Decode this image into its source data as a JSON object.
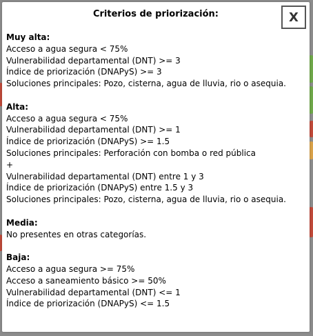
{
  "modal": {
    "title": "Criterios de priorización:",
    "close_label": "X"
  },
  "sections": {
    "muy_alta": {
      "title": "Muy alta:",
      "lines": [
        "Acceso a agua segura < 75%",
        "Vulnerabilidad departamental (DNT) >= 3",
        "Índice de priorización (DNAPyS) >= 3",
        "Soluciones principales: Pozo, cisterna, agua de lluvia, rio o asequia."
      ]
    },
    "alta": {
      "title": "Alta:",
      "lines": [
        "Acceso a agua segura < 75%",
        "Vulnerabilidad departamental (DNT) >= 1",
        "Índice de priorización (DNAPyS) >= 1.5",
        "Soluciones principales: Perforación con bomba o red pública",
        "+",
        "Vulnerabilidad departamental (DNT) entre 1 y 3",
        "Índice de priorización (DNAPyS) entre 1.5 y 3",
        "Soluciones principales: Pozo, cisterna, agua de lluvia, rio o asequia."
      ]
    },
    "media": {
      "title": "Media:",
      "lines": [
        "No presentes en otras categorías."
      ]
    },
    "baja": {
      "title": "Baja:",
      "lines": [
        "Acceso a agua segura >= 75%",
        "Acceso a saneamiento básico >= 50%",
        "Vulnerabilidad departamental (DNT) <= 1",
        "Índice de priorización (DNAPyS) <= 1.5"
      ]
    }
  }
}
